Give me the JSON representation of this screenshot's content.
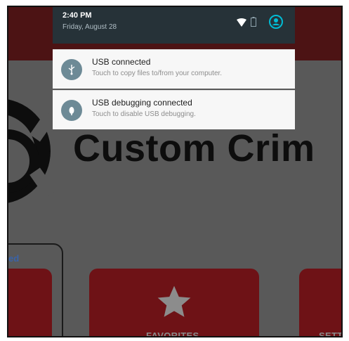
{
  "status": {
    "time": "2:40 PM",
    "date": "Friday, August 28"
  },
  "notifications": [
    {
      "title": "USB connected",
      "text": "Touch to copy files to/from your computer.",
      "icon": "usb-icon"
    },
    {
      "title": "USB debugging connected",
      "text": "Touch to disable USB debugging.",
      "icon": "bug-icon"
    }
  ],
  "app": {
    "title": "Custom Crim",
    "side_label": "ed",
    "tiles": [
      {
        "label": ""
      },
      {
        "label": "FAVORITES",
        "icon": "star-icon"
      },
      {
        "label": "SETT"
      }
    ]
  },
  "colors": {
    "shade_header": "#263238",
    "accent": "#00bcd4",
    "tile_red": "#6e1216",
    "notification_bg": "#f7f7f7"
  }
}
